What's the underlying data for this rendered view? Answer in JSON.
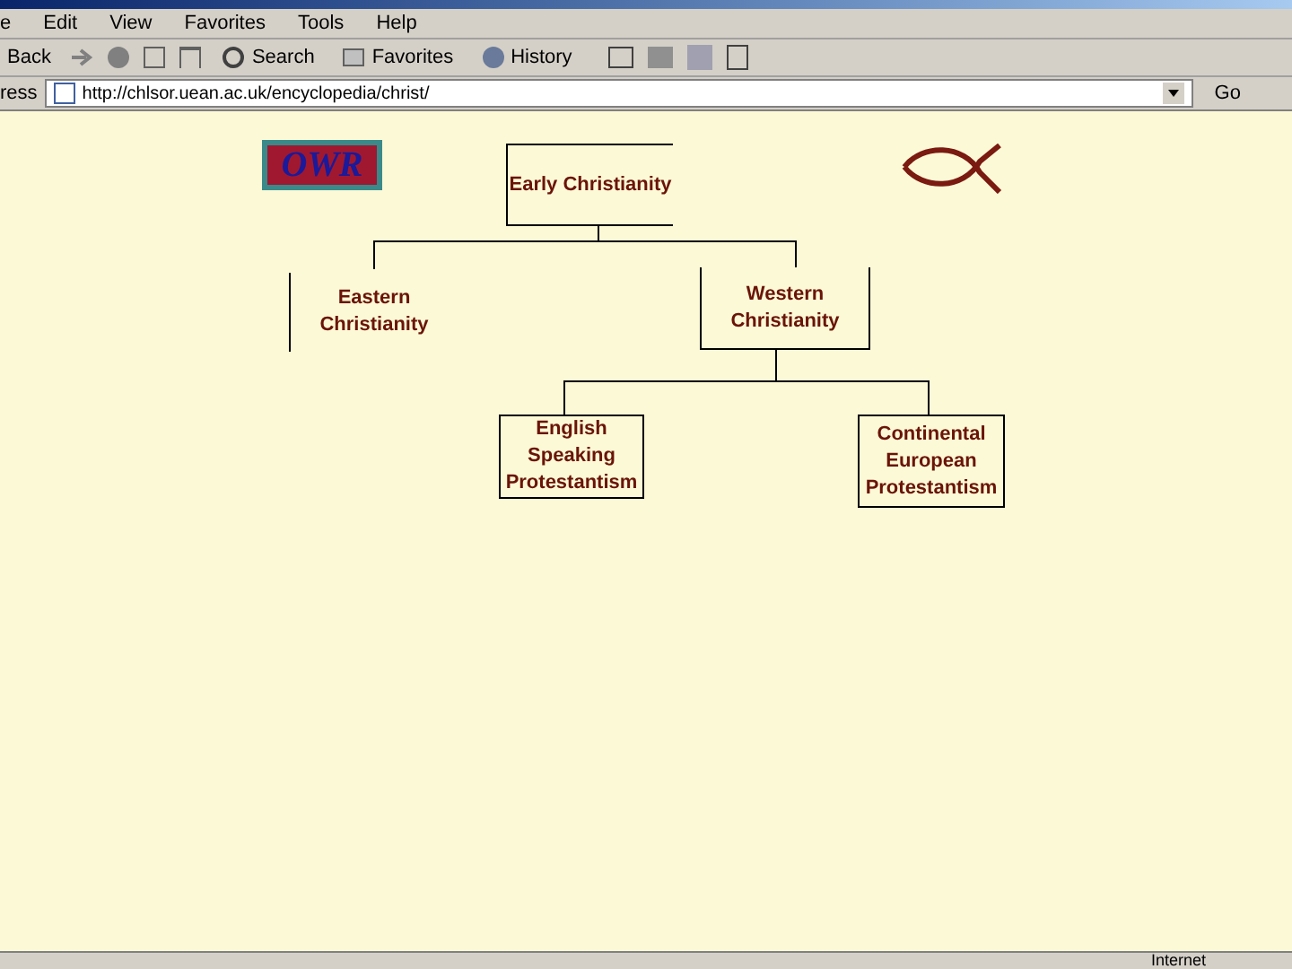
{
  "menu": [
    "e",
    "Edit",
    "View",
    "Favorites",
    "Tools",
    "Help"
  ],
  "toolbar": {
    "back": "Back",
    "search": "Search",
    "favorites": "Favorites",
    "history": "History"
  },
  "address": {
    "label": "ress",
    "url": "http://chlsor.uean.ac.uk/encyclopedia/christ/",
    "go": "Go"
  },
  "logo": "OWR",
  "nodes": [
    {
      "label": "Early Christianity"
    },
    {
      "label": "Eastern Christianity"
    },
    {
      "label": "Western Christianity"
    },
    {
      "label": "English Speaking Protestantism"
    },
    {
      "label": "Continental European Protestantism"
    }
  ],
  "status_bar": {
    "zone": "Internet"
  }
}
